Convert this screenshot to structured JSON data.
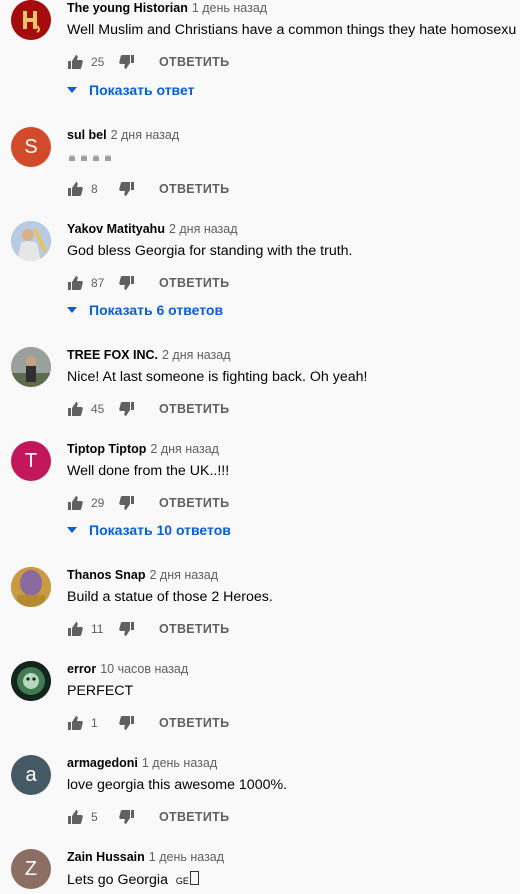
{
  "comments": [
    {
      "author": "The young Historian",
      "time": "1 день назад",
      "text": "Well Muslim and Christians have a common things they hate homosexu",
      "likes": "25",
      "reply": "ОТВЕТИТЬ",
      "show_replies": "Показать ответ",
      "avatar_color": "#a50d0d"
    },
    {
      "author": "sul bel",
      "time": "2 дня назад",
      "text": "",
      "emoji_count": 4,
      "likes": "8",
      "reply": "ОТВЕТИТЬ",
      "avatar_letter": "S",
      "avatar_color": "#d14a2a"
    },
    {
      "author": "Yakov Matityahu",
      "time": "2 дня назад",
      "text": "God bless Georgia for standing with the truth.",
      "likes": "87",
      "reply": "ОТВЕТИТЬ",
      "show_replies": "Показать 6 ответов",
      "avatar_color": "#9fb4c8"
    },
    {
      "author": "TREE FOX INC.",
      "time": "2 дня назад",
      "text": "Nice! At last someone is fighting back.  Oh yeah!",
      "likes": "45",
      "reply": "ОТВЕТИТЬ",
      "avatar_color": "#8a8d8a"
    },
    {
      "author": "Tiptop Tiptop",
      "time": "2 дня назад",
      "text": "Well done from the UK..!!!",
      "likes": "29",
      "reply": "ОТВЕТИТЬ",
      "show_replies": "Показать 10 ответов",
      "avatar_letter": "T",
      "avatar_color": "#c2185b"
    },
    {
      "author": "Thanos Snap",
      "time": "2 дня назад",
      "text": "Build a statue of those 2 Heroes.",
      "likes": "11",
      "reply": "ОТВЕТИТЬ",
      "avatar_color": "#7a5a8c"
    },
    {
      "author": "error",
      "time": "10 часов назад",
      "text": "PERFECT",
      "likes": "1",
      "reply": "ОТВЕТИТЬ",
      "avatar_color": "#1d3a2a"
    },
    {
      "author": "armagedoni",
      "time": "1 день назад",
      "text": "love georgia this awesome 1000%.",
      "likes": "5",
      "reply": "ОТВЕТИТЬ",
      "avatar_letter": "a",
      "avatar_color": "#455a64"
    },
    {
      "author": "Zain Hussain",
      "time": "1 день назад",
      "text": "Lets go Georgia",
      "text_suffix": "GE",
      "likes": "",
      "reply": "",
      "avatar_letter": "Z",
      "avatar_color": "#8d6e63"
    }
  ]
}
